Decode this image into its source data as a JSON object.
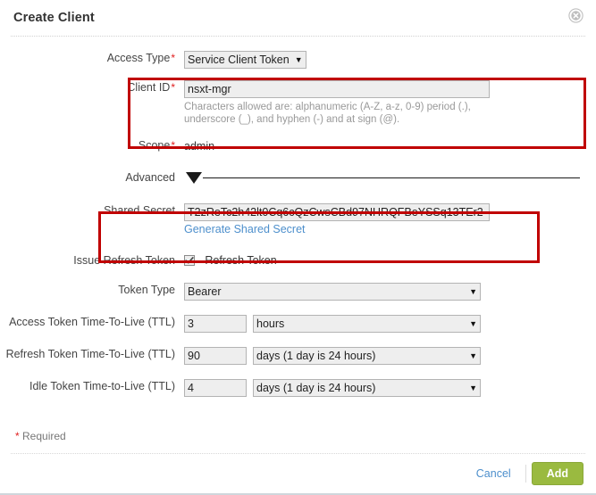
{
  "dialog": {
    "title": "Create Client",
    "close_icon": "close-circle-icon"
  },
  "form": {
    "access_type": {
      "label": "Access Type",
      "required": true,
      "value": "Service Client Token",
      "caret": "▼"
    },
    "client_id": {
      "label": "Client ID",
      "required": true,
      "value": "nsxt-mgr",
      "hint": "Characters allowed are: alphanumeric (A-Z, a-z, 0-9) period (.), underscore (_), and hyphen (-) and at sign (@)."
    },
    "scope": {
      "label": "Scope",
      "required": true,
      "value": "admin"
    },
    "advanced": {
      "label": "Advanced",
      "caret": "advanced-collapse-triangle"
    },
    "shared_secret": {
      "label": "Shared Secret",
      "required": false,
      "value": "T2zReTc2h42lt0Cq6cQzCwsCBd97NHRQFBeYSSq13TEr2",
      "generate_link": "Generate Shared Secret"
    },
    "issue_refresh_token": {
      "label": "Issue Refresh Token",
      "checkbox_label": "Refresh Token",
      "checked": true
    },
    "token_type": {
      "label": "Token Type",
      "value": "Bearer",
      "caret": "▼"
    },
    "access_ttl": {
      "label": "Access Token Time-To-Live (TTL)",
      "amount": "3",
      "unit": "hours",
      "caret": "▼"
    },
    "refresh_ttl": {
      "label": "Refresh Token Time-To-Live (TTL)",
      "amount": "90",
      "unit": "days (1 day is 24 hours)",
      "caret": "▼"
    },
    "idle_ttl": {
      "label": "Idle Token Time-to-Live (TTL)",
      "amount": "4",
      "unit": "days (1 day is 24 hours)",
      "caret": "▼"
    }
  },
  "footer": {
    "required_star": "*",
    "required_note": "Required",
    "cancel_label": "Cancel",
    "add_label": "Add"
  },
  "colors": {
    "accent_link": "#4d8fcc",
    "add_button": "#9aba40",
    "required_red": "#e02020",
    "highlight_box": "#c00000"
  }
}
